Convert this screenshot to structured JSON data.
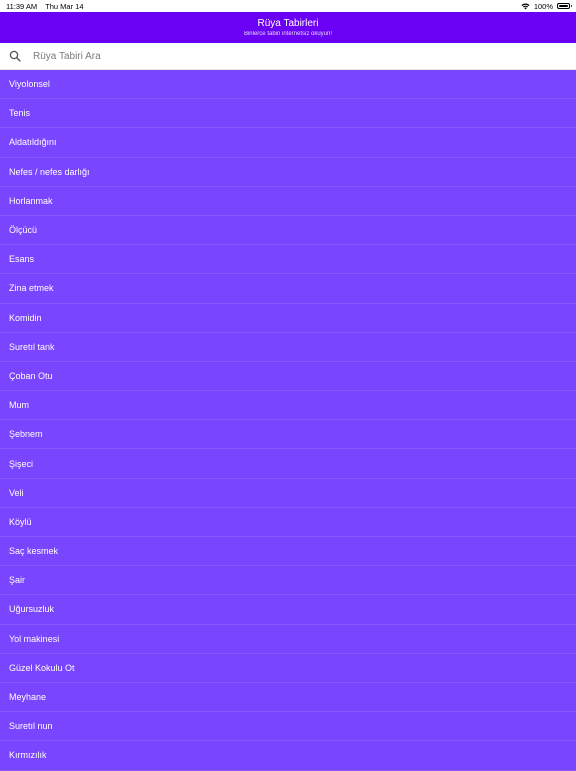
{
  "status_bar": {
    "time": "11:39 AM",
    "date": "Thu Mar 14",
    "battery_percent": "100%",
    "battery_level": 1.0
  },
  "header": {
    "title": "Rüya Tabirleri",
    "subtitle": "Binlerce tabiri internetsiz okuyun!"
  },
  "search": {
    "placeholder": "Rüya Tabiri Ara",
    "value": ""
  },
  "colors": {
    "header_bg": "#6a00f4",
    "list_bg": "#7a45ff"
  },
  "items": [
    "Viyolonsel",
    "Tenis",
    "Aldatıldığını",
    "Nefes / nefes darlığı",
    "Horlanmak",
    "Ölçücü",
    "Esans",
    "Zina etmek",
    "Komidin",
    "Suretıl tank",
    "Çoban Otu",
    "Mum",
    "Şebnem",
    "Şişeci",
    "Veli",
    "Köylü",
    "Saç kesmek",
    "Şair",
    "Uğursuzluk",
    "Yol makinesi",
    "Güzel Kokulu Ot",
    "Meyhane",
    "Suretıl nun",
    "Kırmızılık"
  ]
}
